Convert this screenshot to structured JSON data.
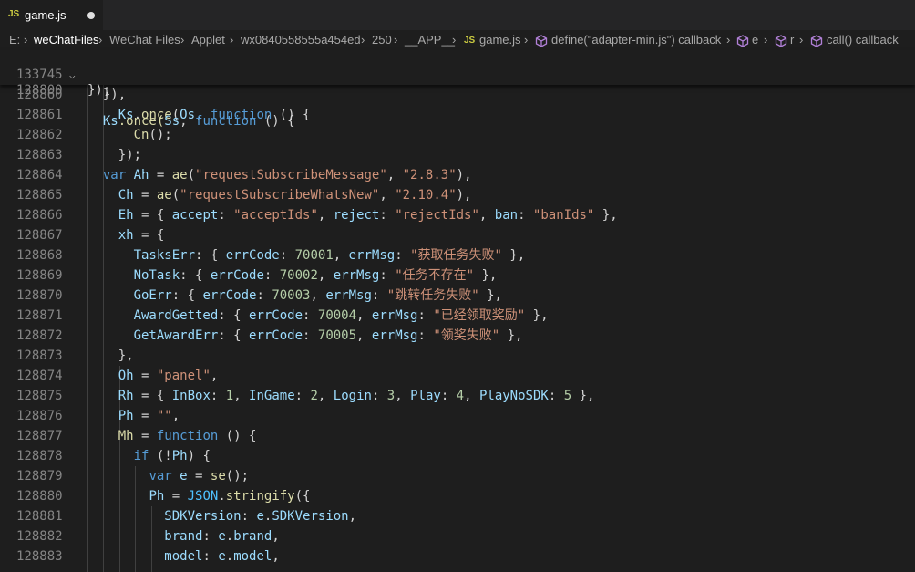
{
  "tab": {
    "icon": "JS",
    "name": "game.js"
  },
  "breadcrumb": {
    "items": [
      "E:",
      "weChatFiles",
      "WeChat Files",
      "Applet",
      "wx0840558555a454ed",
      "250",
      "__APP__",
      "game.js",
      "define(\"adapter-min.js\") callback",
      "e",
      "r",
      "call() callback"
    ],
    "js_icon": "JS"
  },
  "sticky": [
    {
      "num": "133745",
      "text": "});"
    },
    {
      "num": "128800",
      "text": "  Ks.once(Ss, function () {"
    }
  ],
  "lines": [
    {
      "num": "128860"
    },
    {
      "num": "128861"
    },
    {
      "num": "128862"
    },
    {
      "num": "128863"
    },
    {
      "num": "128864"
    },
    {
      "num": "128865"
    },
    {
      "num": "128866"
    },
    {
      "num": "128867"
    },
    {
      "num": "128868"
    },
    {
      "num": "128869"
    },
    {
      "num": "128870"
    },
    {
      "num": "128871"
    },
    {
      "num": "128872"
    },
    {
      "num": "128873"
    },
    {
      "num": "128874"
    },
    {
      "num": "128875"
    },
    {
      "num": "128876"
    },
    {
      "num": "128877"
    },
    {
      "num": "128878"
    },
    {
      "num": "128879"
    },
    {
      "num": "128880"
    },
    {
      "num": "128881"
    },
    {
      "num": "128882"
    },
    {
      "num": "128883"
    }
  ],
  "code_text": {
    "l1": "});",
    "l2_a": "Ks",
    "l2_b": ".once(",
    "l2_c": "Ss",
    "l2_d": ", ",
    "l2_e": "function",
    "l2_f": " () {",
    "s": {
      "api1": "\"requestSubscribeMessage\"",
      "v1": "\"2.8.3\"",
      "api2": "\"requestSubscribeWhatsNew\"",
      "v2": "\"2.10.4\"",
      "acc": "\"acceptIds\"",
      "rej": "\"rejectIds\"",
      "ban": "\"banIds\"",
      "m1": "获取任务失败",
      "m2": "任务不存在",
      "m3": "跳转任务失败",
      "m4": "已经领取奖励",
      "m5": "领奖失败",
      "panel": "\"panel\"",
      "empty": "\"\""
    },
    "n": {
      "e1": "70001",
      "e2": "70002",
      "e3": "70003",
      "e4": "70004",
      "e5": "70005",
      "one": "1",
      "two": "2",
      "three": "3",
      "four": "4",
      "five": "5"
    }
  }
}
